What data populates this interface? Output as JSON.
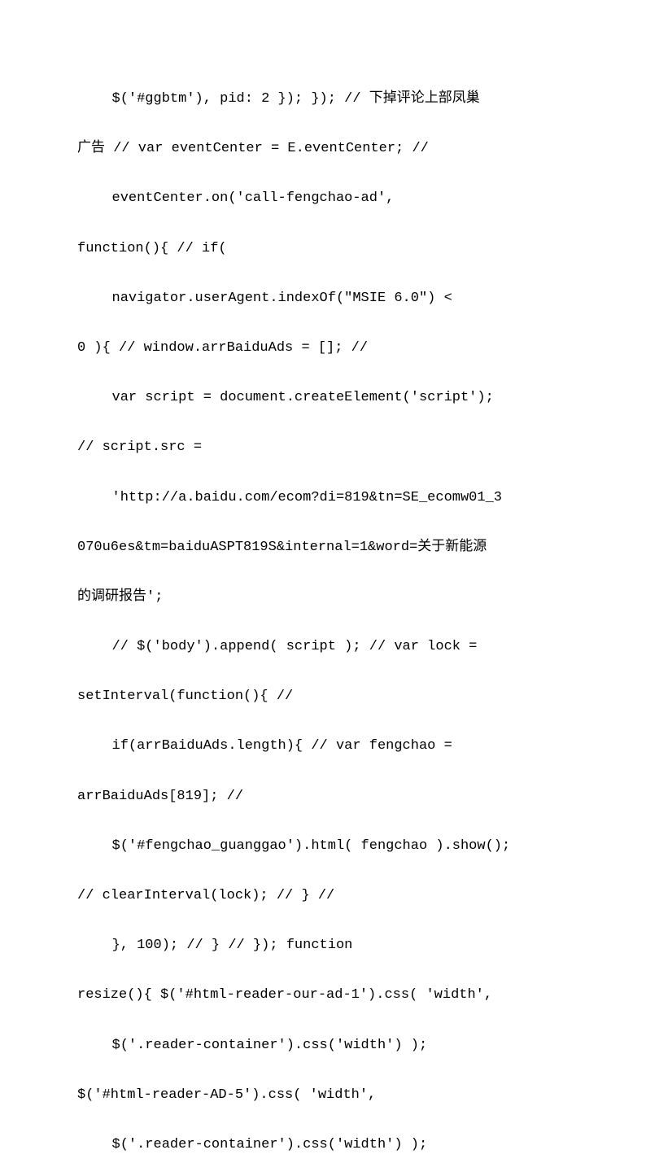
{
  "lines": [
    {
      "cls": "para",
      "text": "$('#ggbtm'), pid: 2 }); }); // 下掉评论上部凤巢"
    },
    {
      "cls": "flush",
      "text": "广告 // var eventCenter = E.eventCenter; //"
    },
    {
      "cls": "para",
      "text": "eventCenter.on('call-fengchao-ad', "
    },
    {
      "cls": "flush",
      "text": "function(){ // if("
    },
    {
      "cls": "para",
      "text": "navigator.userAgent.indexOf(\"MSIE   6.0\")   < "
    },
    {
      "cls": "flush",
      "text": "0 ){ // window.arrBaiduAds = []; //"
    },
    {
      "cls": "para",
      "text": "var script = document.createElement('script'); "
    },
    {
      "cls": "flush",
      "text": "// script.src ="
    },
    {
      "cls": "para",
      "text": "'http://a.baidu.com/ecom?di=819&tn=SE_ecomw01_3"
    },
    {
      "cls": "flush",
      "text": "070u6es&tm=baiduASPT819S&internal=1&word=关于新能源"
    },
    {
      "cls": "flush",
      "text": "的调研报告';"
    },
    {
      "cls": "para",
      "text": "// $('body').append( script ); // var lock = "
    },
    {
      "cls": "flush",
      "text": "setInterval(function(){ //"
    },
    {
      "cls": "para",
      "text": "if(arrBaiduAds.length){  //  var  fengchao  = "
    },
    {
      "cls": "flush",
      "text": "arrBaiduAds[819]; //"
    },
    {
      "cls": "para",
      "text": "$('#fengchao_guanggao').html( fengchao ).show(); "
    },
    {
      "cls": "flush",
      "text": "// clearInterval(lock); // } //"
    },
    {
      "cls": "para",
      "text": "},   100);   //   }   //   });   function "
    },
    {
      "cls": "flush",
      "text": "resize(){ $('#html-reader-our-ad-1').css( 'width',"
    },
    {
      "cls": "para",
      "text": "$('.reader-container').css('width')        ); "
    },
    {
      "cls": "flush",
      "text": "$('#html-reader-AD-5').css( 'width',"
    },
    {
      "cls": "para",
      "text": "$('.reader-container').css('width')        ); "
    }
  ]
}
